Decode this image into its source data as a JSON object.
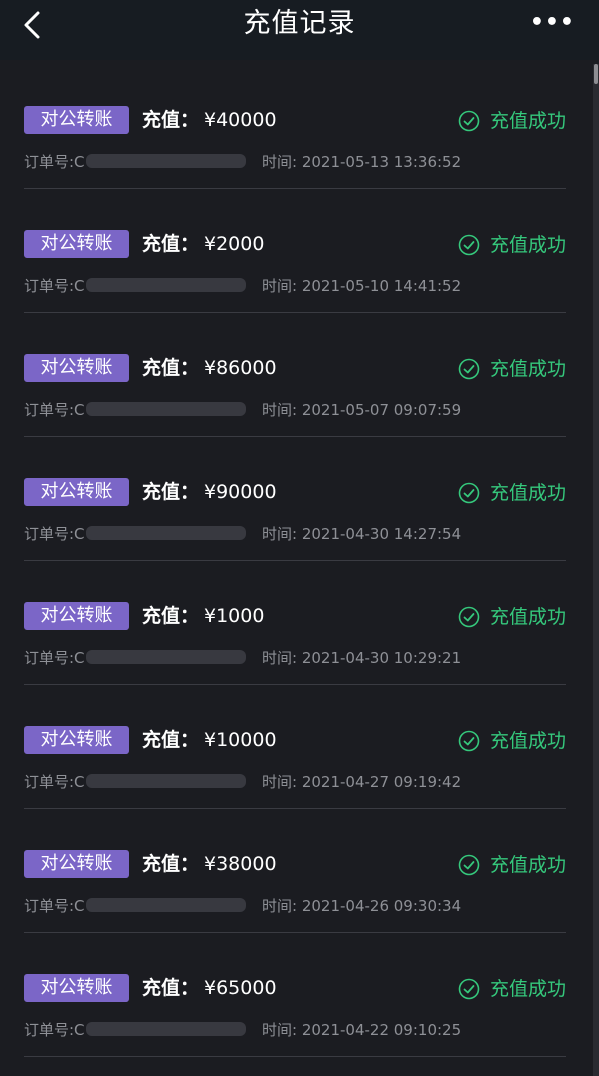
{
  "header": {
    "title": "充值记录",
    "back_icon": "chevron-left-icon",
    "more_label": "•••"
  },
  "records": [
    {
      "tag": "对公转账",
      "amount_label": "充值：",
      "amount": "¥40000",
      "status": "充值成功",
      "order_prefix": "订单号:C",
      "time": "时间: 2021-05-13 13:36:52"
    },
    {
      "tag": "对公转账",
      "amount_label": "充值：",
      "amount": "¥2000",
      "status": "充值成功",
      "order_prefix": "订单号:C",
      "time": "时间: 2021-05-10 14:41:52"
    },
    {
      "tag": "对公转账",
      "amount_label": "充值：",
      "amount": "¥86000",
      "status": "充值成功",
      "order_prefix": "订单号:C",
      "time": "时间: 2021-05-07 09:07:59"
    },
    {
      "tag": "对公转账",
      "amount_label": "充值：",
      "amount": "¥90000",
      "status": "充值成功",
      "order_prefix": "订单号:C",
      "time": "时间: 2021-04-30 14:27:54"
    },
    {
      "tag": "对公转账",
      "amount_label": "充值：",
      "amount": "¥1000",
      "status": "充值成功",
      "order_prefix": "订单号:C",
      "time": "时间: 2021-04-30 10:29:21"
    },
    {
      "tag": "对公转账",
      "amount_label": "充值：",
      "amount": "¥10000",
      "status": "充值成功",
      "order_prefix": "订单号:C",
      "time": "时间: 2021-04-27 09:19:42"
    },
    {
      "tag": "对公转账",
      "amount_label": "充值：",
      "amount": "¥38000",
      "status": "充值成功",
      "order_prefix": "订单号:C",
      "time": "时间: 2021-04-26 09:30:34"
    },
    {
      "tag": "对公转账",
      "amount_label": "充值：",
      "amount": "¥65000",
      "status": "充值成功",
      "order_prefix": "订单号:C",
      "time": "时间: 2021-04-22 09:10:25"
    }
  ],
  "colors": {
    "background": "#1b1c21",
    "tag": "#7b66c7",
    "success": "#35c87c"
  }
}
